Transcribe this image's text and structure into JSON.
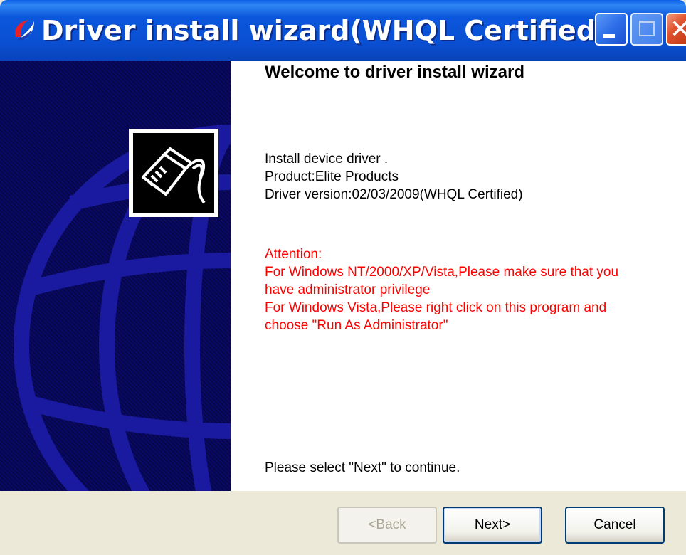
{
  "window": {
    "title": "Driver install wizard(WHQL Certified)",
    "icon": "app-logo-icon",
    "title_buttons": [
      "minimize",
      "maximize",
      "close"
    ]
  },
  "content": {
    "heading": "Welcome to driver install wizard",
    "info_lines": [
      "Install device driver .",
      "Product:Elite Products",
      "Driver version:02/03/2009(WHQL Certified)"
    ],
    "attention_lines": [
      "Attention:",
      "For Windows NT/2000/XP/Vista,Please make sure that you",
      "have administrator privilege",
      "For Windows Vista,Please right click on this program and",
      "choose \"Run As Administrator\""
    ],
    "footnote": "Please select \"Next\" to continue."
  },
  "buttons": {
    "back": "<Back",
    "next": "Next>",
    "cancel": "Cancel"
  },
  "colors": {
    "titlebar": "#0a4fd2",
    "side_panel": "#0a0a66",
    "globe": "#1a1aa0",
    "attention_text": "#ff0000",
    "dialog_bg": "#ece9d8"
  },
  "side_graphic": {
    "icon": "network-cable-icon",
    "background": "globe-graphic"
  }
}
